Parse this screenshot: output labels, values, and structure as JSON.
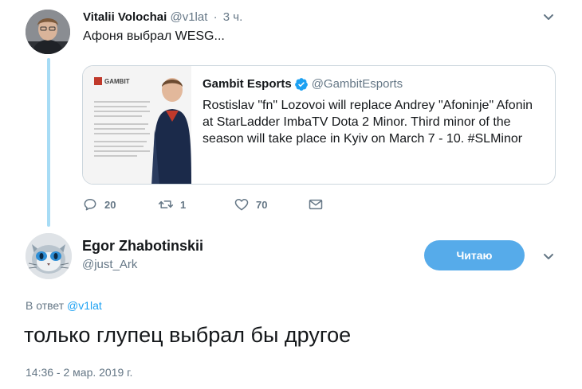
{
  "parent_tweet": {
    "name": "Vitalii Volochai",
    "handle": "@v1lat",
    "separator": "·",
    "time": "3 ч.",
    "text": "Афоня выбрал WESG...",
    "avatar_icon": "user-avatar-photo",
    "menu_icon": "chevron-down-icon"
  },
  "quoted_tweet": {
    "name": "Gambit Esports",
    "verified_icon": "verified-badge-icon",
    "handle": "@GambitEsports",
    "text": "Rostislav \"fn\" Lozovoi will replace Andrey \"Afoninje\" Afonin at StarLadder ImbaTV Dota 2 Minor. Third minor of the season will take place in Kyiv on March 7 - 10. #SLMinor",
    "media_icon": "announcement-image",
    "media_logo_text": "GAMBIT"
  },
  "actions": {
    "reply_count": "20",
    "retweet_count": "1",
    "like_count": "70",
    "reply_icon": "reply-icon",
    "retweet_icon": "retweet-icon",
    "like_icon": "heart-icon",
    "dm_icon": "envelope-icon"
  },
  "reply_tweet": {
    "name": "Egor Zhabotinskii",
    "handle": "@just_Ark",
    "follow_button": "Читаю",
    "in_reply_label": "В ответ",
    "in_reply_mention": "@v1lat",
    "text": "только глупец выбрал бы другое",
    "timestamp": "14:36 - 2 мар. 2019 г.",
    "avatar_icon": "cat-avatar-icon",
    "menu_icon": "chevron-down-icon"
  },
  "colors": {
    "link": "#1da1f2",
    "follow_button_bg": "#56abea",
    "thread_line": "#a7dcf5",
    "secondary_text": "#657786"
  }
}
